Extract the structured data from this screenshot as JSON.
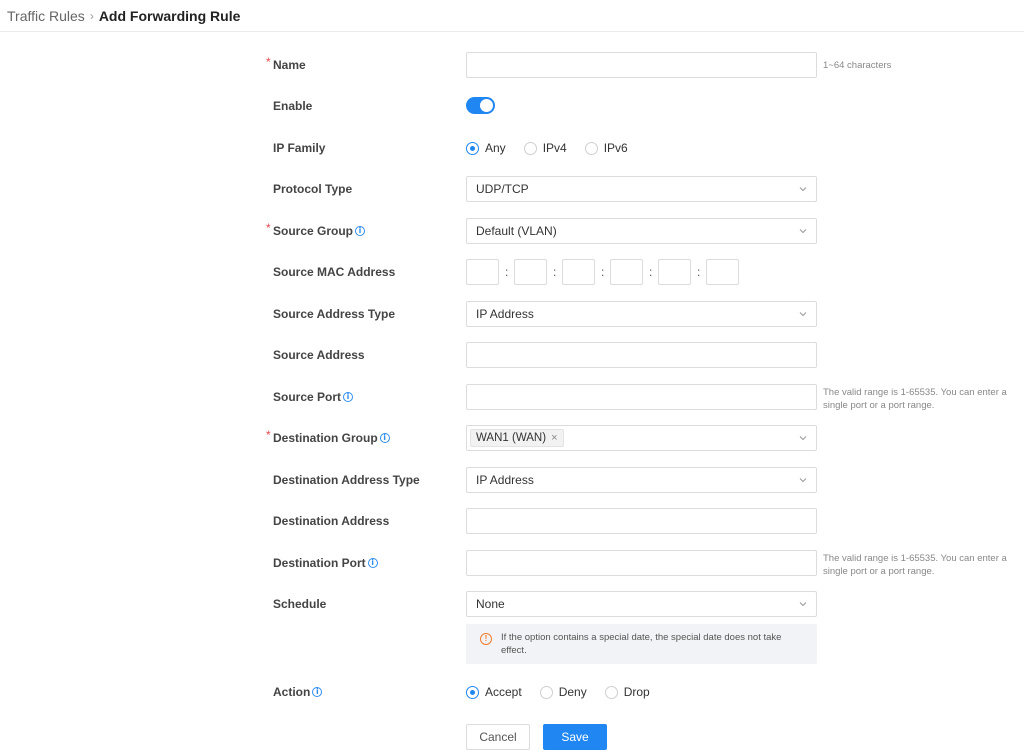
{
  "breadcrumb": {
    "parent": "Traffic Rules",
    "separator": "›",
    "current": "Add Forwarding Rule"
  },
  "form": {
    "name": {
      "label": "Name",
      "required": "*",
      "value": "",
      "hint": "1~64 characters"
    },
    "enable": {
      "label": "Enable",
      "on": true
    },
    "ip_family": {
      "label": "IP Family",
      "options": [
        "Any",
        "IPv4",
        "IPv6"
      ],
      "selected": "Any"
    },
    "protocol_type": {
      "label": "Protocol Type",
      "value": "UDP/TCP"
    },
    "source_group": {
      "label": "Source Group",
      "required": "*",
      "value": "Default (VLAN)"
    },
    "source_mac": {
      "label": "Source MAC Address",
      "separator": ":"
    },
    "source_address_type": {
      "label": "Source Address Type",
      "value": "IP Address"
    },
    "source_address": {
      "label": "Source Address",
      "value": ""
    },
    "source_port": {
      "label": "Source Port",
      "value": "",
      "hint": "The valid range is 1-65535. You can enter a single port or a port range."
    },
    "destination_group": {
      "label": "Destination Group",
      "required": "*",
      "tag": "WAN1 (WAN)",
      "tag_remove": "×"
    },
    "destination_address_type": {
      "label": "Destination Address Type",
      "value": "IP Address"
    },
    "destination_address": {
      "label": "Destination Address",
      "value": ""
    },
    "destination_port": {
      "label": "Destination Port",
      "value": "",
      "hint": "The valid range is 1-65535. You can enter a single port or a port range."
    },
    "schedule": {
      "label": "Schedule",
      "value": "None",
      "notice": "If the option contains a special date, the special date does not take effect."
    },
    "action": {
      "label": "Action",
      "options": [
        "Accept",
        "Deny",
        "Drop"
      ],
      "selected": "Accept"
    }
  },
  "buttons": {
    "cancel": "Cancel",
    "save": "Save"
  },
  "icons": {
    "info": "info-icon",
    "warning": "warning-icon",
    "dropdown": "chevron-down-icon"
  },
  "colors": {
    "accent": "#1f86f2",
    "required": "#e5484d",
    "warning": "#f27c2e"
  }
}
